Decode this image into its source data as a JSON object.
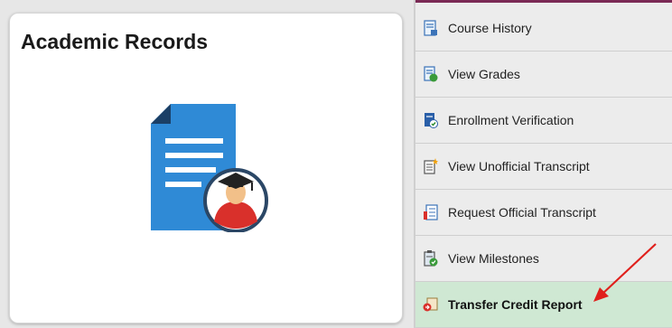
{
  "tile": {
    "title": "Academic Records",
    "icon": "document-graduate-icon"
  },
  "menu": {
    "items": [
      {
        "label": "Course History",
        "icon": "course-history-icon"
      },
      {
        "label": "View Grades",
        "icon": "grades-icon"
      },
      {
        "label": "Enrollment Verification",
        "icon": "verification-icon"
      },
      {
        "label": "View Unofficial Transcript",
        "icon": "transcript-icon"
      },
      {
        "label": "Request Official Transcript",
        "icon": "request-transcript-icon"
      },
      {
        "label": "View Milestones",
        "icon": "milestones-icon"
      },
      {
        "label": "Transfer Credit Report",
        "icon": "transfer-credit-icon",
        "active": true
      }
    ]
  },
  "colors": {
    "accent_line": "#7b2a55",
    "active_bg": "#cfe8d3",
    "arrow": "#e0201c",
    "doc_blue": "#2f8ad6"
  }
}
